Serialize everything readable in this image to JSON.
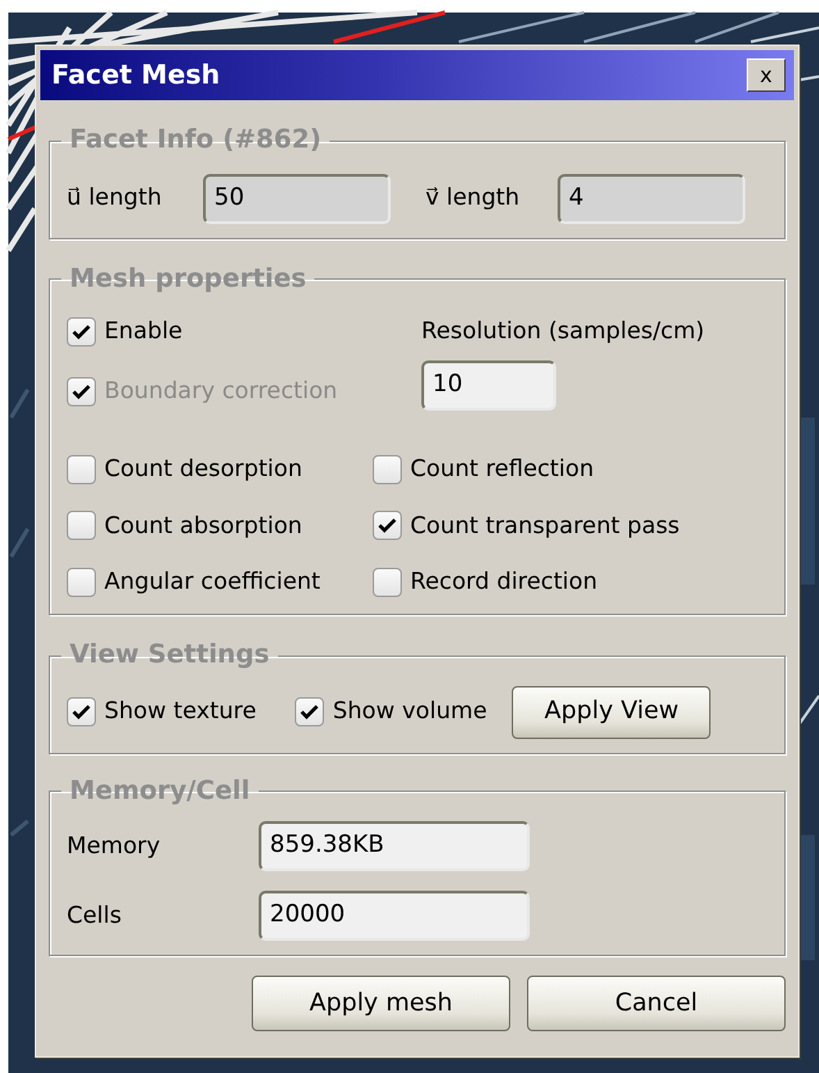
{
  "window": {
    "title": "Facet Mesh",
    "close": "x"
  },
  "facet_info": {
    "title": "Facet Info (#862)",
    "fields": [
      {
        "label": "u⃗ length",
        "value": "50",
        "disabled": true
      },
      {
        "label": "v⃗ length",
        "value": "4",
        "disabled": true
      }
    ]
  },
  "mesh_properties": {
    "title": "Mesh properties",
    "checks": [
      {
        "label": "Enable",
        "checked": true,
        "disabled": false
      },
      {
        "label": "Boundary correction",
        "checked": true,
        "disabled": true
      }
    ],
    "resolution": {
      "label": "Resolution (samples/cm)",
      "value": "10"
    },
    "options": [
      {
        "label": "Count desorption",
        "checked": false
      },
      {
        "label": "Count reflection",
        "checked": false
      },
      {
        "label": "Count absorption",
        "checked": false
      },
      {
        "label": "Count transparent pass",
        "checked": true
      },
      {
        "label": "Angular coefficient",
        "checked": false
      },
      {
        "label": "Record direction",
        "checked": false
      }
    ]
  },
  "view_settings": {
    "title": "View Settings",
    "options": [
      {
        "label": "Show texture",
        "checked": true
      },
      {
        "label": "Show volume",
        "checked": true
      }
    ],
    "apply_button": "Apply View"
  },
  "memory_cell": {
    "title": "Memory/Cell",
    "fields": [
      {
        "label": "Memory",
        "value": "859.38KB",
        "disabled": false
      },
      {
        "label": "Cells",
        "value": "20000",
        "disabled": false
      }
    ]
  },
  "buttons": [
    "Apply mesh",
    "Cancel"
  ]
}
